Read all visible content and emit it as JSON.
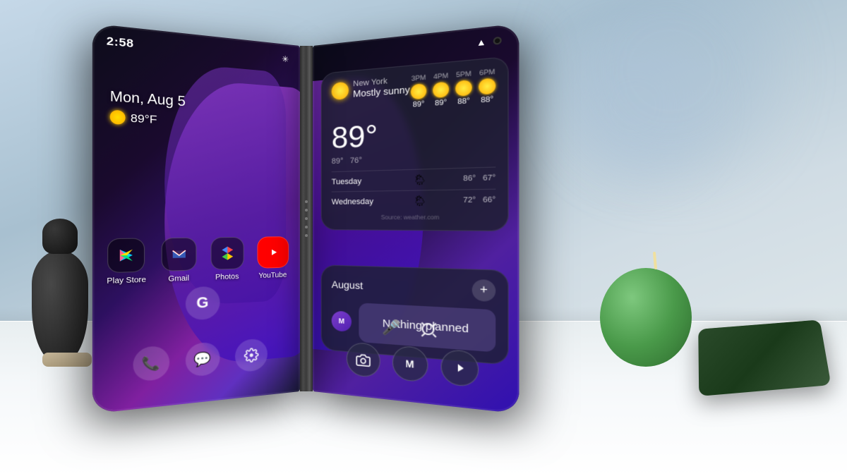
{
  "scene": {
    "background": "blurred indoor environment",
    "table_color": "#f0f4f5"
  },
  "left_screen": {
    "status_bar": {
      "time": "2:58",
      "indicator": "✳"
    },
    "date": "Mon, Aug 5",
    "temperature": "89°F",
    "app_icons": [
      {
        "name": "Play Store",
        "label": "Play Store",
        "bg": "#0f0f0f",
        "icon": "▶"
      },
      {
        "name": "Gmail",
        "label": "Gmail",
        "bg": "#0f0f0f",
        "icon": "M"
      },
      {
        "name": "Photos",
        "label": "Photos",
        "bg": "#0f0f0f",
        "icon": "✿"
      },
      {
        "name": "YouTube",
        "label": "YouTube",
        "bg": "#0f0f0f",
        "icon": "▶"
      }
    ],
    "dock": [
      {
        "name": "Phone",
        "icon": "📞"
      },
      {
        "name": "Messages",
        "icon": "💬"
      },
      {
        "name": "Settings",
        "icon": "⚙"
      }
    ]
  },
  "right_screen": {
    "weather_widget": {
      "location": "New York",
      "condition": "Mostly sunny",
      "temp": "89°",
      "low": "89°",
      "high": "76°",
      "hourly": [
        {
          "time": "3PM",
          "temp": "89°",
          "icon": "sun"
        },
        {
          "time": "4PM",
          "temp": "89°",
          "icon": "sun"
        },
        {
          "time": "5PM",
          "temp": "88°",
          "icon": "sun"
        },
        {
          "time": "6PM",
          "temp": "88°",
          "icon": "sun"
        }
      ],
      "daily": [
        {
          "day": "Tuesday",
          "high": "86°",
          "low": "67°",
          "icon": "cloud-rain"
        },
        {
          "day": "Wednesday",
          "high": "72°",
          "low": "66°",
          "icon": "cloud-rain"
        }
      ],
      "source": "Source: weather.com"
    },
    "calendar_widget": {
      "month": "August",
      "add_button": "+",
      "avatar_initial": "M",
      "nothing_planned": "Nothing planned"
    },
    "bottom_controls": [
      "🎤",
      "⊙"
    ],
    "dock": [
      {
        "name": "Camera",
        "icon": "📷"
      },
      {
        "name": "Messages",
        "icon": "M"
      },
      {
        "name": "YouTube",
        "icon": "▶"
      }
    ]
  }
}
